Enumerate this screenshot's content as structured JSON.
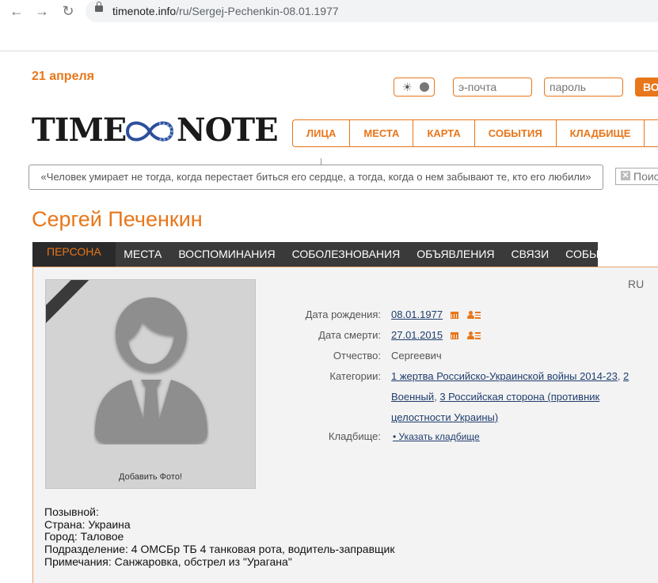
{
  "browser": {
    "url_host": "timenote.info",
    "url_path": "/ru/Sergej-Pechenkin-08.01.1977"
  },
  "header": {
    "date": "21 апреля",
    "email_placeholder": "э-почта",
    "password_placeholder": "пароль",
    "login_label": "ВО",
    "logo_left": "TIME",
    "logo_right": "NOTE",
    "search_label": "Поис"
  },
  "mainnav": {
    "items": [
      {
        "label": "ЛИЦА"
      },
      {
        "label": "МЕСТА"
      },
      {
        "label": "КАРТА"
      },
      {
        "label": "СОБЫТИЯ"
      },
      {
        "label": "КЛАДБИЩЕ"
      },
      {
        "label": "О"
      }
    ]
  },
  "quote": "«Человек умирает не тогда, когда перестает биться его сердце, а тогда, когда о нем забывают те, кто его любили»",
  "person": {
    "name": "Сергей Печенкин",
    "language": "RU",
    "add_photo": "Добавить Фото!",
    "tabs": [
      {
        "label": "ПЕРСОНА",
        "active": true
      },
      {
        "label": "МЕСТА"
      },
      {
        "label": "ВОСПОМИНАНИЯ"
      },
      {
        "label": "СОБОЛЕЗНОВАНИЯ"
      },
      {
        "label": "ОБЪЯВЛЕНИЯ"
      },
      {
        "label": "СВЯЗИ"
      },
      {
        "label": "СОБЫТИЯ"
      }
    ],
    "birth_label": "Дата рождения:",
    "birth_date": "08.01.1977",
    "death_label": "Дата смерти:",
    "death_date": "27.01.2015",
    "patronymic_label": "Отчество:",
    "patronymic": "Сергеевич",
    "categories_label": "Категории:",
    "categories": [
      "1 жертва Российско-Украинской войны 2014-23",
      "2 Военный",
      "3 Российская сторона (противник целостности Украины)"
    ],
    "cemetery_label": "Кладбище:",
    "cemetery_link": "• Указать кладбище",
    "bio": [
      "Позывной:",
      "Страна: Украина",
      "Город: Таловое",
      "Подразделение: 4 ОМСБр ТБ 4 танковая рота, водитель-заправщик",
      "Примечания: Санжаровка, обстрел из \"Урагана\""
    ]
  },
  "colors": {
    "accent": "#e8761a",
    "tabs_bg": "#3a3a3a",
    "link": "#1f3d6e"
  }
}
